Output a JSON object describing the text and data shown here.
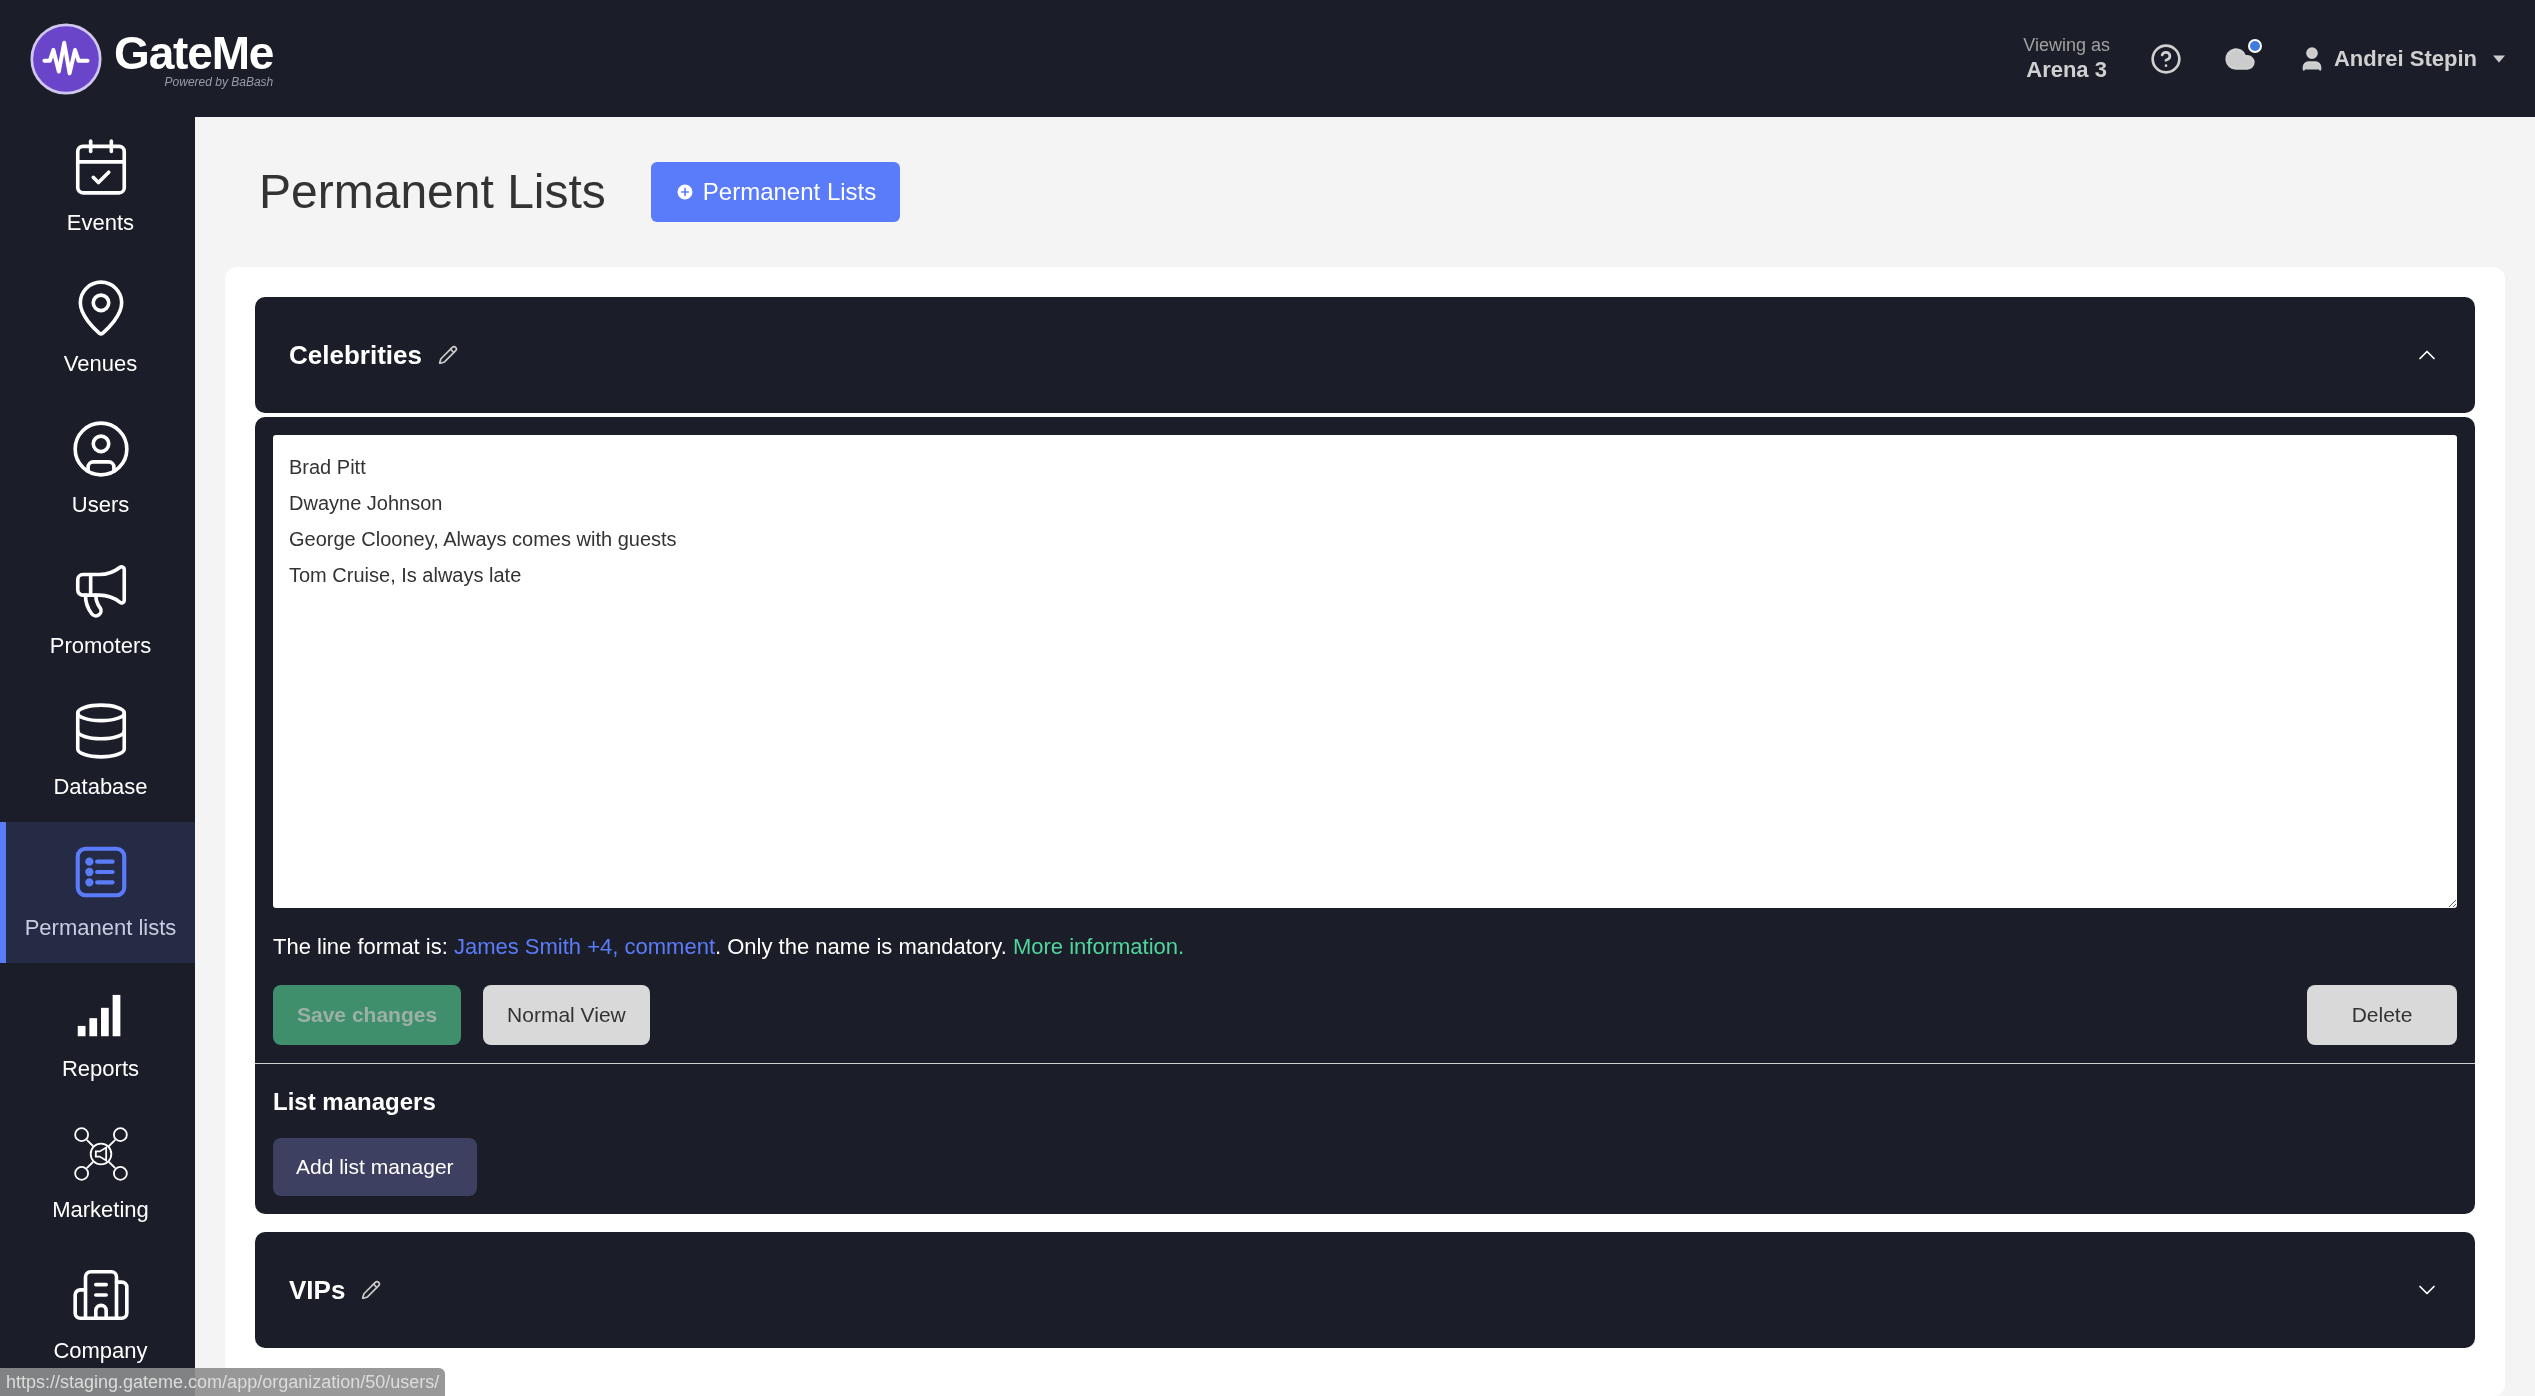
{
  "header": {
    "logo": "GateMe",
    "tagline": "Powered by BaBash",
    "viewing_label": "Viewing as",
    "viewing_value": "Arena 3",
    "notification_dot": true,
    "user": "Andrei Stepin"
  },
  "sidebar": {
    "items": [
      {
        "label": "Events",
        "selected": false
      },
      {
        "label": "Venues",
        "selected": false
      },
      {
        "label": "Users",
        "selected": false
      },
      {
        "label": "Promoters",
        "selected": false
      },
      {
        "label": "Database",
        "selected": false
      },
      {
        "label": "Permanent lists",
        "selected": true
      },
      {
        "label": "Reports",
        "selected": false
      },
      {
        "label": "Marketing",
        "selected": false
      },
      {
        "label": "Company",
        "selected": false
      }
    ]
  },
  "page": {
    "title": "Permanent Lists",
    "add_button": "Permanent Lists"
  },
  "lists": [
    {
      "name": "Celebrities",
      "expanded": true,
      "entries": "Brad Pitt\nDwayne Johnson\nGeorge Clooney, Always comes with guests\nTom Cruise, Is always late",
      "format_prefix": "The line format is: ",
      "format_example": "James Smith +4, comment",
      "format_middle": ". Only the name is mandatory. ",
      "more_link": "More information.",
      "save_button": {
        "label": "Save changes",
        "disabled": true
      },
      "view_button": "Normal View",
      "delete_button": "Delete",
      "managers_title": "List managers",
      "add_manager_button": "Add list manager"
    },
    {
      "name": "VIPs",
      "expanded": false
    }
  ],
  "status_bar": {
    "url": "https://staging.gateme.com/app/organization/50/users/"
  }
}
